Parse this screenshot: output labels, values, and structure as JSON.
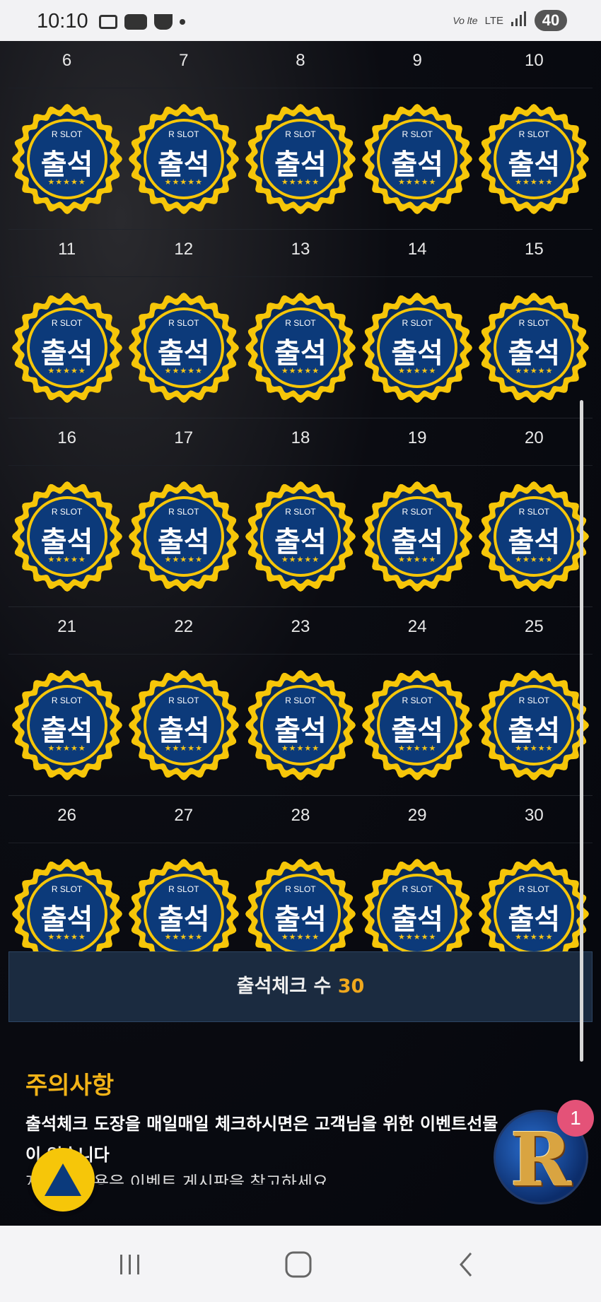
{
  "status_bar": {
    "time": "10:10",
    "network": "LTE",
    "volte": "Vo lte",
    "battery": "40",
    "icons": [
      "screenshot-icon",
      "youtube-icon",
      "coffee-icon",
      "dot-icon"
    ]
  },
  "calendar": {
    "badge_brand": "R SLOT",
    "badge_word": "출석",
    "badge_stars": "★★★★★",
    "rows": [
      {
        "days": [
          "6",
          "7",
          "8",
          "9",
          "10"
        ]
      },
      {
        "days": [
          "11",
          "12",
          "13",
          "14",
          "15"
        ]
      },
      {
        "days": [
          "16",
          "17",
          "18",
          "19",
          "20"
        ]
      },
      {
        "days": [
          "21",
          "22",
          "23",
          "24",
          "25"
        ]
      },
      {
        "days": [
          "26",
          "27",
          "28",
          "29",
          "30"
        ]
      }
    ]
  },
  "summary": {
    "label": "출석체크 수 ",
    "count": "30"
  },
  "notice": {
    "title": "주의사항",
    "line1": "출석체크 도장을 매일매일 체크하시면은 고객님을 위한 이벤트선물이 있습니다",
    "line2": "자세한 내용은 이벤트 게시판을 참고하세요"
  },
  "fab": {
    "letter": "R",
    "notification_count": "1"
  },
  "colors": {
    "badge_outer": "#f6c609",
    "badge_inner": "#0c3a7a",
    "accent": "#f0a81d",
    "summary_bg": "#1b2b40"
  },
  "nav": {
    "items": [
      "recent-apps-icon",
      "home-icon",
      "back-icon"
    ]
  }
}
